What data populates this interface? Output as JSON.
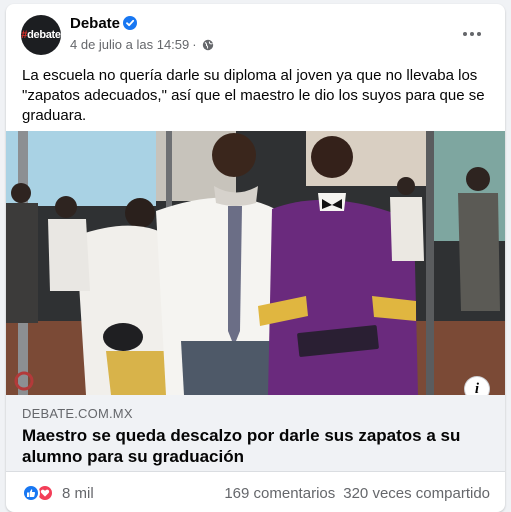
{
  "post": {
    "page_name": "Debate",
    "avatar_text": "debate",
    "avatar_hash": "#",
    "timestamp": "4 de julio a las 14:59",
    "separator": "·",
    "text": "La escuela no quería darle su diploma al joven ya que no llevaba los \"zapatos adecuados,\" así que el maestro le dio los suyos para que se graduara."
  },
  "link_preview": {
    "domain": "DEBATE.COM.MX",
    "headline": "Maestro se queda descalzo por darle sus zapatos a su alumno para su graduación"
  },
  "engagement": {
    "reactions_count": "8 mil",
    "comments": "169 comentarios",
    "shares": "320 veces compartido"
  },
  "icons": {
    "verified": "verified-badge-icon",
    "privacy": "globe-icon",
    "more": "more-options-icon",
    "info": "info-icon",
    "reactions": [
      "like-icon",
      "love-icon"
    ]
  },
  "colors": {
    "accent": "#1877f2",
    "love": "#f33e58",
    "secondary_text": "#65676b",
    "preview_bg": "#f0f2f5"
  }
}
